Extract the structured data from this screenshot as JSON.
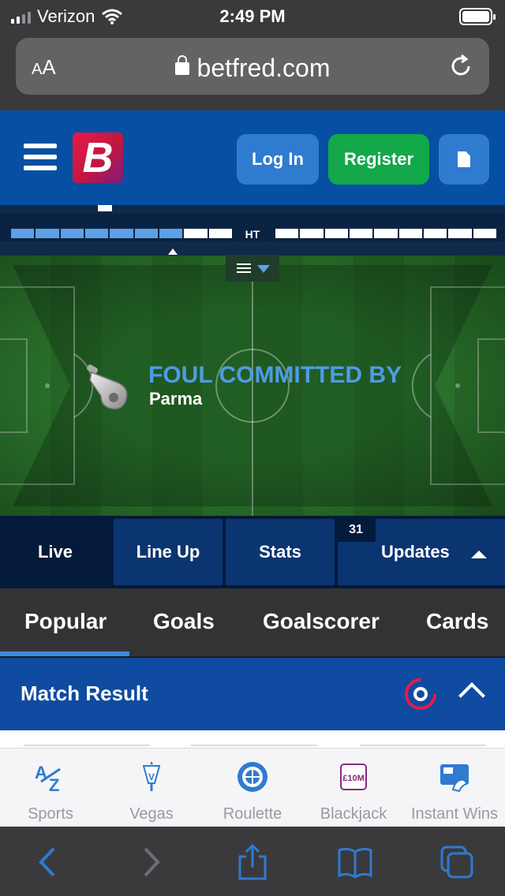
{
  "status_bar": {
    "carrier": "Verizon",
    "time": "2:49 PM"
  },
  "browser": {
    "text_size_label": "AA",
    "url": "betfred.com"
  },
  "header": {
    "logo_letter": "B",
    "login_label": "Log In",
    "register_label": "Register"
  },
  "match_tracker": {
    "period_label": "HT",
    "event_title": "FOUL COMMITTED BY",
    "event_team": "Parma",
    "first_half_progress": 0.75
  },
  "match_tabs": [
    {
      "label": "Live"
    },
    {
      "label": "Line Up"
    },
    {
      "label": "Stats"
    },
    {
      "label": "Updates",
      "badge": "31"
    }
  ],
  "market_tabs": [
    {
      "label": "Popular"
    },
    {
      "label": "Goals"
    },
    {
      "label": "Goalscorer"
    },
    {
      "label": "Cards"
    }
  ],
  "market": {
    "title": "Match Result"
  },
  "app_nav": [
    {
      "label": "Sports",
      "icon": "a-z-icon"
    },
    {
      "label": "Vegas",
      "icon": "vegas-sign-icon"
    },
    {
      "label": "Roulette",
      "icon": "roulette-wheel-icon"
    },
    {
      "label": "Blackjack",
      "icon": "ten-million-badge-icon",
      "icon_text": "£10M"
    },
    {
      "label": "Instant Wins",
      "icon": "scratch-card-icon"
    }
  ],
  "colors": {
    "brand_blue": "#064fa2",
    "register_green": "#13a84a",
    "accent_blue": "#3a8be0",
    "logo_red": "#e8194a"
  }
}
